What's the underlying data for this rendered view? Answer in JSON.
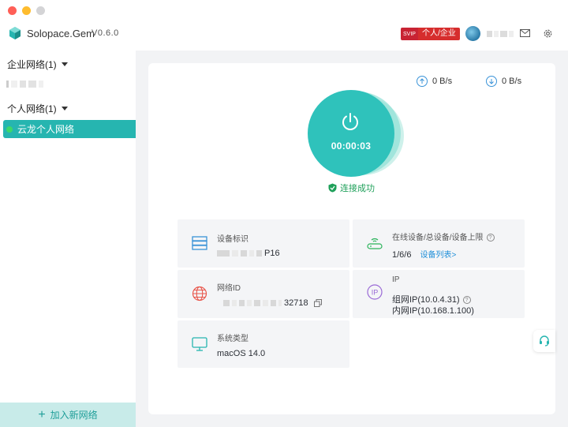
{
  "window": {
    "app_name": "Solopace.Gem",
    "version": "V0.6.0"
  },
  "header": {
    "plan_badge_label": "个人/企业",
    "plan_icon_text": "SVIP"
  },
  "sidebar": {
    "groups": [
      {
        "label": "企业网络(1)"
      },
      {
        "label": "个人网络(1)"
      }
    ],
    "active_network": {
      "label": "云龙个人网络",
      "status_color": "#3cd86a"
    },
    "add_button_label": "加入新网络"
  },
  "main": {
    "upload_speed": "0 B/s",
    "download_speed": "0 B/s",
    "timer": "00:00:03",
    "status_text": "连接成功",
    "tiles": {
      "device_id": {
        "label": "设备标识",
        "value_suffix": "P16"
      },
      "online_devices": {
        "label": "在线设备/总设备/设备上限",
        "value": "1/6/6",
        "link": "设备列表>"
      },
      "network_id": {
        "label": "网络ID",
        "value_suffix": "32718"
      },
      "ip": {
        "label": "IP",
        "group_ip": "组网IP(10.0.4.31)",
        "lan_ip": "内网IP(10.168.1.100)"
      },
      "os": {
        "label": "系统类型",
        "value": "macOS 14.0"
      }
    }
  },
  "colors": {
    "accent": "#26b5b0",
    "success": "#1fa05a",
    "link": "#1f8fd8",
    "badge": "#d62d2d"
  }
}
